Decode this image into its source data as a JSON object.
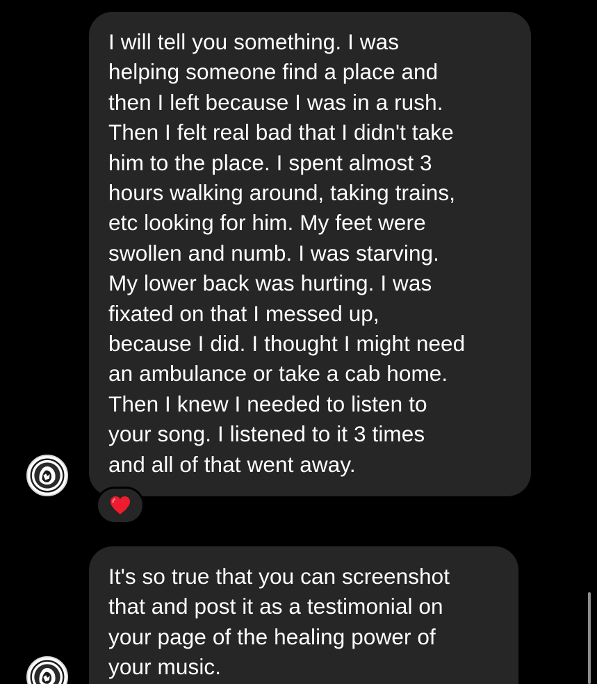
{
  "colors": {
    "background": "#000000",
    "bubble": "#262626",
    "text": "#ffffff",
    "heart": "#ed1c2e"
  },
  "messages": [
    {
      "sender": "other",
      "lines": [
        "I will tell you something. I was",
        "helping someone find a place and",
        "then I left because I was in a rush.",
        "Then I felt real bad that I didn't take",
        "him to the place. I spent almost 3",
        "hours walking around, taking trains,",
        "etc looking for him. My feet were",
        "swollen and numb. I was starving.",
        "My lower back was hurting. I was",
        "fixated on that I messed up,",
        "because I did. I thought I might need",
        "an ambulance or take a cab home.",
        "Then I knew I needed to listen to",
        "your song. I listened to it 3 times",
        "and all of that went away."
      ],
      "reaction": "heart-icon"
    },
    {
      "sender": "other",
      "lines": [
        "It's so true that you can screenshot",
        "that and post it as a testimonial on",
        "your page of the healing power of",
        "your music."
      ]
    }
  ],
  "avatar_icon": "lion-emblem-icon"
}
